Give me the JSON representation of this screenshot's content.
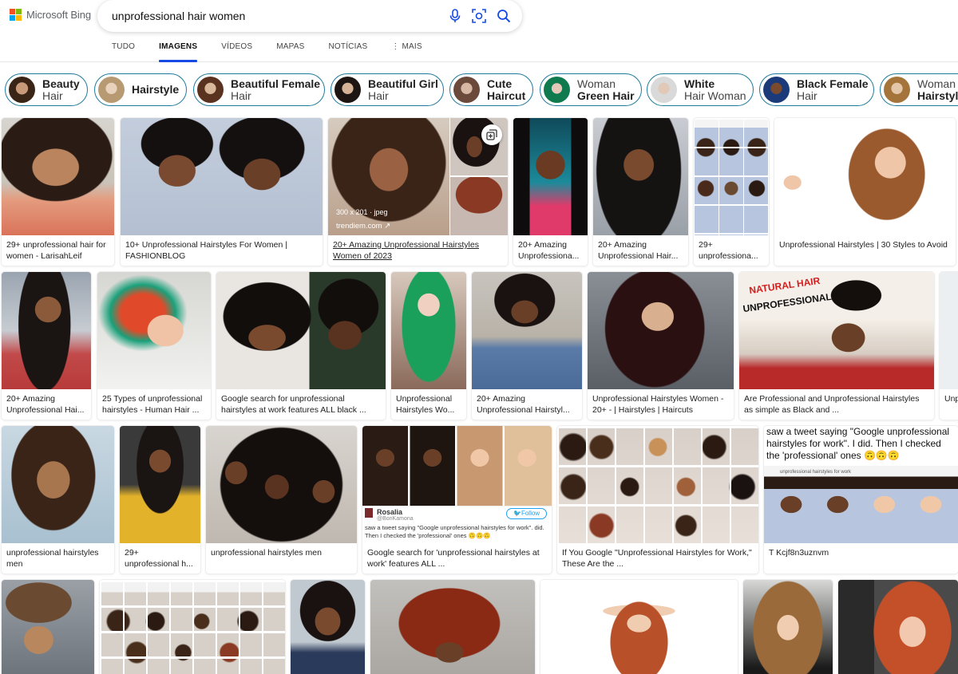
{
  "brand": {
    "name": "Microsoft Bing",
    "colors": [
      "#f25022",
      "#7fba00",
      "#00a4ef",
      "#ffb900"
    ]
  },
  "search": {
    "query": "unprofessional hair women"
  },
  "tabs": [
    {
      "label": "TUDO",
      "active": false
    },
    {
      "label": "IMAGENS",
      "active": true
    },
    {
      "label": "VÍDEOS",
      "active": false
    },
    {
      "label": "MAPAS",
      "active": false
    },
    {
      "label": "NOTÍCIAS",
      "active": false
    },
    {
      "label": "MAIS",
      "active": false
    }
  ],
  "chips": [
    {
      "bold": "Beauty",
      "normal": "Hair"
    },
    {
      "bold": "Hairstyle",
      "normal": ""
    },
    {
      "bold": "Beautiful Female",
      "normal": "Hair"
    },
    {
      "bold": "Beautiful Girl",
      "normal": "Hair"
    },
    {
      "bold": "Cute",
      "normal": "Haircut",
      "both_bold": true
    },
    {
      "bold": "Woman",
      "normal": "Green Hair",
      "invert": true
    },
    {
      "bold": "White",
      "normal": "Hair Woman"
    },
    {
      "bold": "Black Female",
      "normal": "Hair"
    },
    {
      "bold": "Woman",
      "normal": "Hairstyle",
      "invert": true
    }
  ],
  "results": {
    "r1": [
      "29+ unprofessional hair for women - LarisahLeif",
      "10+ Unprofessional Hairstyles For Women | FASHIONBLOG",
      "20+ Amazing Unprofessional Hairstyles Women of 2023",
      "20+ Amazing Unprofessiona...",
      "20+ Amazing Unprofessional Hair...",
      "29+ unprofessiona...",
      "Unprofessional Hairstyles | 30 Styles to Avoid"
    ],
    "r2": [
      "20+ Amazing Unprofessional Hai...",
      "25 Types of unprofessional hairstyles - Human Hair ...",
      "Google search for unprofessional hairstyles at work features ALL black ...",
      "Unprofessional Hairstyles Wo...",
      "20+ Amazing Unprofessional Hairstyl...",
      "Unprofessional Hairstyles Women - 20+ - | Hairstyles | Haircuts",
      "Are Professional and Unprofessional Hairstyles as simple as Black and ...",
      "Unp"
    ],
    "r3": [
      "unprofessional hairstyles men",
      "29+ unprofessional h...",
      "unprofessional hairstyles men",
      "Google search for 'unprofessional hairstyles at work' features ALL ...",
      "If You Google \"Unprofessional Hairstyles for Work,\" These Are the ...",
      "T Kcjf8n3uznvm"
    ]
  },
  "hover_meta": {
    "size": "300 x 201 · jpeg",
    "source": "trendiem.com"
  },
  "image_text": {
    "natural_hair": "NATURAL HAIR",
    "unprofessional": "UNPROFESSIONAL???",
    "tweet_name": "Rosalia",
    "tweet_handle": "@BonKamona",
    "tweet_follow": "Follow",
    "tweet_text": "saw a tweet saying \"Google unprofessional hairstyles for work\". did. Then I checked the 'professional' ones 🙃🙃🙃",
    "tweet_big": "saw a tweet saying \"Google unprofessional hairstyles for work\". I did. Then I checked the 'professional' ones 🙃🙃🙃",
    "shot_header": "unprofessional hairstyles for work"
  }
}
